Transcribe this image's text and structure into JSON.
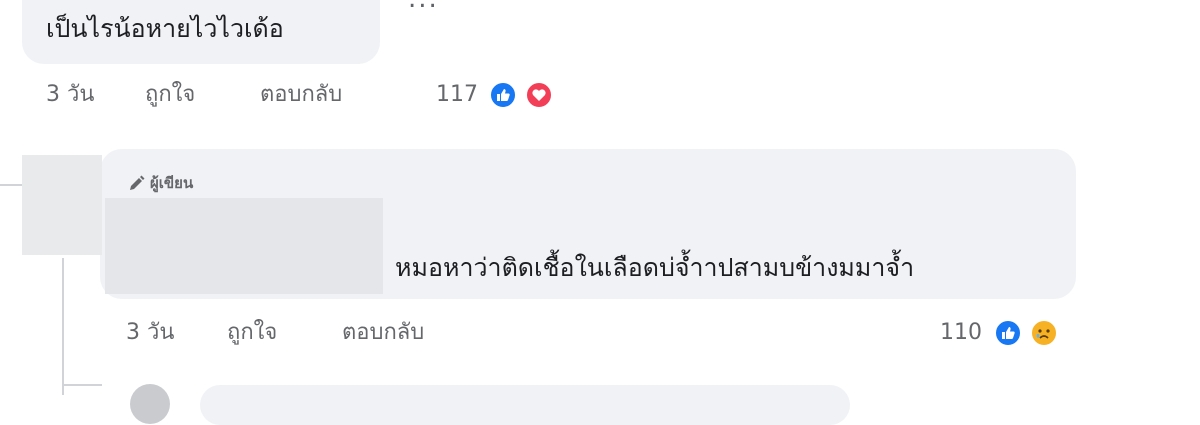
{
  "comment": {
    "text": "เป็นไรน้อหายไวไวเด้อ",
    "more": "...",
    "time": "3 วัน",
    "like": "ถูกใจ",
    "reply": "ตอบกลับ",
    "reaction_count": "117",
    "reactions": [
      "like-icon",
      "love-icon"
    ]
  },
  "reply": {
    "badge": "ผู้เขียน",
    "text": "หมอหาว่าติดเชื้อในเลือดบ่จ้ำาปสามบข้างมมาจ้ำ",
    "time": "3 วัน",
    "like": "ถูกใจ",
    "reply": "ตอบกลับ",
    "reaction_count": "110",
    "reactions": [
      "like-icon",
      "sad-icon"
    ]
  },
  "colors": {
    "bubble": "#f0f2f5",
    "meta": "#65676b",
    "like": "#1877f2",
    "love": "#f33e58",
    "sad": "#f7b125"
  }
}
